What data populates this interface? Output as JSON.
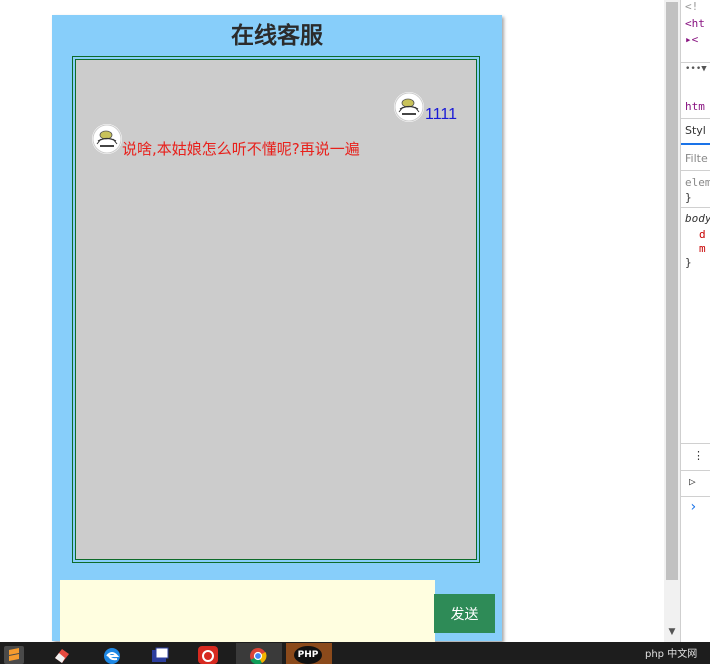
{
  "chat": {
    "title": "在线客服",
    "messages": [
      {
        "sender": "user",
        "text": "1111",
        "color": "#1a1ad6"
      },
      {
        "sender": "bot",
        "text": "说啥,本姑娘怎么听不懂呢?再说一遍",
        "color": "#e8201b"
      }
    ],
    "input_value": "",
    "send_label": "发送"
  },
  "devtools": {
    "lines": [
      "<!",
      "<ht",
      "▸<",
      "•••▼",
      "htm",
      "Styl",
      "Filte",
      "elem",
      "}",
      "body",
      "d",
      "m",
      "}",
      "⋮",
      "▷",
      "›"
    ]
  },
  "taskbar": {
    "icons": [
      "sublime-icon",
      "eraser-icon",
      "edge-icon",
      "tool-icon",
      "netease-music-icon",
      "chrome-icon",
      "php-icon"
    ],
    "php_label": "PHP",
    "watermark": "php 中文网"
  },
  "colors": {
    "panel_bg": "#87cefa",
    "chat_bg": "#cccccc",
    "input_bg": "#fffee0",
    "send_bg": "#2e8b57",
    "taskbar_bg": "#1d1d1d"
  }
}
